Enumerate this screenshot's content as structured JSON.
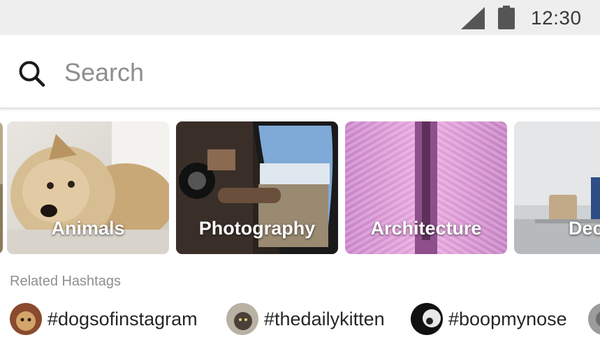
{
  "status_bar": {
    "time": "12:30",
    "signal_icon": "cell-signal-icon",
    "battery_icon": "battery-icon"
  },
  "search": {
    "placeholder": "Search",
    "value": "",
    "icon": "search-icon"
  },
  "categories": [
    {
      "label": "Animals"
    },
    {
      "label": "Photography"
    },
    {
      "label": "Architecture"
    },
    {
      "label": "Dec"
    }
  ],
  "related": {
    "heading": "Related Hashtags",
    "tags": [
      {
        "label": "#dogsofinstagram"
      },
      {
        "label": "#thedailykitten"
      },
      {
        "label": "#boopmynose"
      }
    ]
  },
  "colors": {
    "status_bar_bg": "#eeeeee",
    "text_primary": "#262626",
    "text_secondary": "#8e8e8e"
  }
}
